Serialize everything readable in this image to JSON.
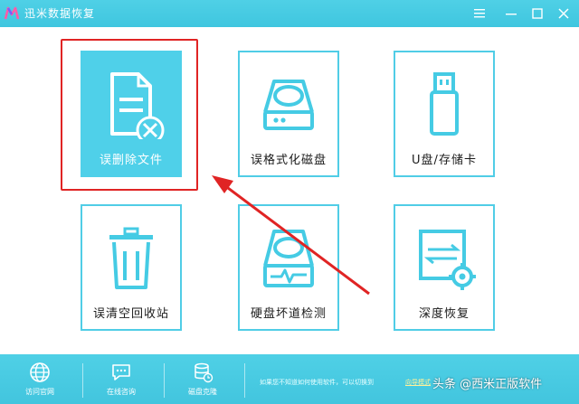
{
  "app": {
    "title": "迅米数据恢复"
  },
  "tiles": [
    {
      "label": "误删除文件"
    },
    {
      "label": "误格式化磁盘"
    },
    {
      "label": "U盘/存储卡"
    },
    {
      "label": "误清空回收站"
    },
    {
      "label": "硬盘坏道检测"
    },
    {
      "label": "深度恢复"
    }
  ],
  "bottom": {
    "items": [
      {
        "label": "访问官网"
      },
      {
        "label": "在线咨询"
      },
      {
        "label": "磁盘克隆"
      }
    ],
    "tip": "如果您不知道如何使用软件，可以切换到",
    "link": "向导模式"
  },
  "watermark": "头条 @西米正版软件",
  "colors": {
    "accent": "#4fd0e9",
    "highlight": "#e02424",
    "icon_stroke": "#45cbe4"
  }
}
